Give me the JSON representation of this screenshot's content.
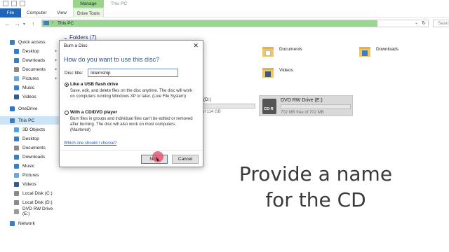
{
  "window": {
    "title": "This PC",
    "contextual_tab": "Manage"
  },
  "ribbon": {
    "tabs": [
      "File",
      "Computer",
      "View",
      "Drive Tools"
    ]
  },
  "address": {
    "path": "This PC",
    "search_placeholder": "Searc"
  },
  "sidebar": {
    "items": [
      {
        "label": "Quick access",
        "icon": "star-icon",
        "color": "#3c7fc0"
      },
      {
        "label": "Desktop",
        "icon": "desktop-icon",
        "color": "#3c7fc0",
        "pinned": true
      },
      {
        "label": "Downloads",
        "icon": "download-icon",
        "color": "#3c7fc0",
        "pinned": true
      },
      {
        "label": "Documents",
        "icon": "documents-icon",
        "color": "#8a8a8a",
        "pinned": true
      },
      {
        "label": "Pictures",
        "icon": "pictures-icon",
        "color": "#6aa8d8",
        "pinned": true
      },
      {
        "label": "Music",
        "icon": "music-icon",
        "color": "#3c7fc0"
      },
      {
        "label": "Videos",
        "icon": "videos-icon",
        "color": "#3c5a88"
      },
      {
        "label": "OneDrive",
        "icon": "cloud-icon",
        "color": "#2e74c9"
      },
      {
        "label": "This PC",
        "icon": "pc-icon",
        "color": "#3c7fc0",
        "selected": true
      },
      {
        "label": "3D Objects",
        "icon": "cube-icon",
        "color": "#5ca0d6"
      },
      {
        "label": "Desktop",
        "icon": "desktop-icon",
        "color": "#3c7fc0"
      },
      {
        "label": "Documents",
        "icon": "documents-icon",
        "color": "#8a8a8a"
      },
      {
        "label": "Downloads",
        "icon": "download-icon",
        "color": "#3c7fc0"
      },
      {
        "label": "Music",
        "icon": "music-icon",
        "color": "#3c7fc0"
      },
      {
        "label": "Pictures",
        "icon": "pictures-icon",
        "color": "#6aa8d8"
      },
      {
        "label": "Videos",
        "icon": "videos-icon",
        "color": "#3c5a88"
      },
      {
        "label": "Local Disk (C:)",
        "icon": "drive-icon",
        "color": "#8a8a8a"
      },
      {
        "label": "Local Disk (D:)",
        "icon": "drive-icon",
        "color": "#8a8a8a"
      },
      {
        "label": "DVD RW Drive (E:)",
        "icon": "disc-icon",
        "color": "#9a9a9a"
      },
      {
        "label": "Network",
        "icon": "network-icon",
        "color": "#3c7fc0"
      }
    ]
  },
  "content": {
    "folders_header": "Folders (7)",
    "folders": [
      {
        "label": "Documents",
        "icon": "documents-folder-icon"
      },
      {
        "label": "Downloads",
        "icon": "downloads-folder-icon"
      },
      {
        "label": "Videos",
        "icon": "videos-folder-icon"
      }
    ],
    "drives": [
      {
        "label": "(D:)",
        "sub": "of 114 GB",
        "used_fraction": 0.0
      },
      {
        "label": "DVD RW Drive (E:)",
        "sub": "702 MB free of 702 MB",
        "badge": "CD-R",
        "used_fraction": 0.0
      }
    ]
  },
  "dialog": {
    "title": "Burn a Disc",
    "heading": "How do you want to use this disc?",
    "disc_title_label": "Disc title:",
    "disc_title_value": "Internship",
    "option1_title": "Like a USB flash drive",
    "option1_desc": "Save, edit, and delete files on the disc anytime. The disc will work on computers running Windows XP or later. (Live File System)",
    "option2_title": "With a CD/DVD player",
    "option2_desc": "Burn files in groups and individual files can't be edited or removed after burning. The disc will also work on most computers. (Mastered)",
    "help_link": "Which one should I choose?",
    "next_label": "Next",
    "cancel_label": "Cancel"
  },
  "caption": {
    "line1": "Provide a name",
    "line2": "for the CD"
  }
}
